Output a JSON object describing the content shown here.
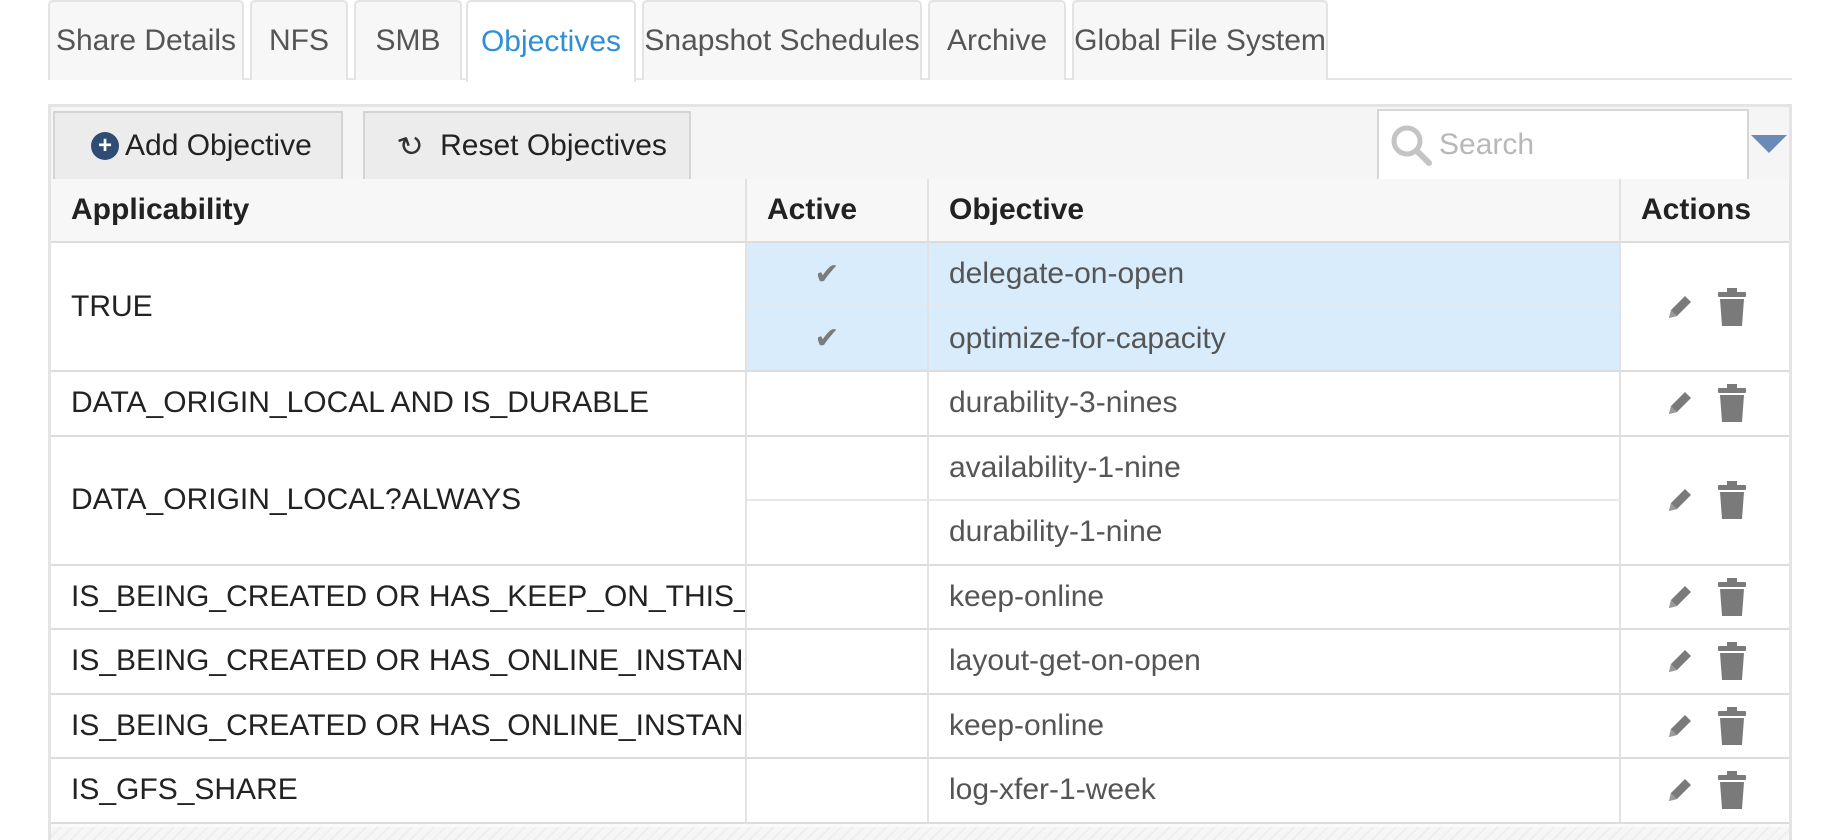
{
  "tabs": [
    {
      "label": "Share Details",
      "active": false
    },
    {
      "label": "NFS",
      "active": false
    },
    {
      "label": "SMB",
      "active": false
    },
    {
      "label": "Objectives",
      "active": true
    },
    {
      "label": "Snapshot Schedules",
      "active": false
    },
    {
      "label": "Archive",
      "active": false
    },
    {
      "label": "Global File System",
      "active": false
    }
  ],
  "toolbar": {
    "add_label": "Add Objective",
    "reset_label": "Reset Objectives",
    "search_placeholder": "Search",
    "add_icon": "plus-circle-icon",
    "reset_icon": "refresh-icon",
    "search_icon": "search-icon",
    "dropdown_icon": "caret-down-icon"
  },
  "table": {
    "headers": {
      "applicability": "Applicability",
      "active": "Active",
      "objective": "Objective",
      "actions": "Actions"
    },
    "active_mark": "✔",
    "groups": [
      {
        "applicability": "TRUE",
        "selected": true,
        "objectives": [
          {
            "name": "delegate-on-open",
            "active": true
          },
          {
            "name": "optimize-for-capacity",
            "active": true
          }
        ]
      },
      {
        "applicability": "DATA_ORIGIN_LOCAL AND IS_DURABLE",
        "selected": false,
        "objectives": [
          {
            "name": "durability-3-nines",
            "active": false
          }
        ]
      },
      {
        "applicability": "DATA_ORIGIN_LOCAL?ALWAYS",
        "selected": false,
        "objectives": [
          {
            "name": "availability-1-nine",
            "active": false
          },
          {
            "name": "durability-1-nine",
            "active": false
          }
        ]
      },
      {
        "applicability": "IS_BEING_CREATED OR HAS_KEEP_ON_THIS_SITE",
        "selected": false,
        "objectives": [
          {
            "name": "keep-online",
            "active": false
          }
        ]
      },
      {
        "applicability": "IS_BEING_CREATED OR HAS_ONLINE_INSTANCE",
        "selected": false,
        "objectives": [
          {
            "name": "layout-get-on-open",
            "active": false
          }
        ]
      },
      {
        "applicability": "IS_BEING_CREATED OR HAS_ONLINE_INSTANCE ...",
        "selected": false,
        "objectives": [
          {
            "name": "keep-online",
            "active": false
          }
        ]
      },
      {
        "applicability": "IS_GFS_SHARE",
        "selected": false,
        "objectives": [
          {
            "name": "log-xfer-1-week",
            "active": false
          }
        ]
      }
    ],
    "row_actions": {
      "edit_icon": "pencil-icon",
      "delete_icon": "trash-icon"
    },
    "colors": {
      "highlight": "#d8ecfb",
      "link": "#2f8fd6",
      "icon_gray": "#7a7a7a"
    }
  }
}
